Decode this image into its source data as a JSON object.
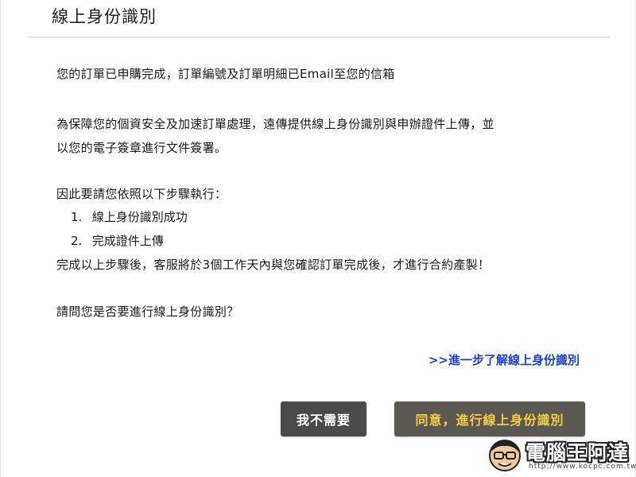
{
  "dialog": {
    "title": "線上身份識別",
    "paragraph1": "您的訂單已申購完成，訂單編號及訂單明細已Email至您的信箱",
    "paragraph2_line1": "為保障您的個資安全及加速訂單處理，遠傳提供線上身份識別與申辦證件上傳，並",
    "paragraph2_line2": "以您的電子簽章進行文件簽署。",
    "steps_intro": "因此要請您依照以下步驟執行：",
    "steps": [
      {
        "number": "1.",
        "text": "線上身份識別成功"
      },
      {
        "number": "2.",
        "text": "完成證件上傳"
      }
    ],
    "after_steps": "完成以上步驟後，客服將於3個工作天內與您確認訂單完成後，才進行合約產製！",
    "question": "請問您是否要進行線上身份識別？",
    "learn_more_link": ">>進一步了解線上身份識別",
    "decline_button": "我不需要",
    "agree_button": "同意，進行線上身份識別"
  },
  "watermark": {
    "text": "電腦王阿達",
    "url": "http://www.kocpc.com.tw"
  },
  "colors": {
    "link": "#1a3fd6",
    "decline_bg": "#4a4a4a",
    "agree_bg": "#5b5751",
    "agree_text": "#f3cc3f"
  }
}
